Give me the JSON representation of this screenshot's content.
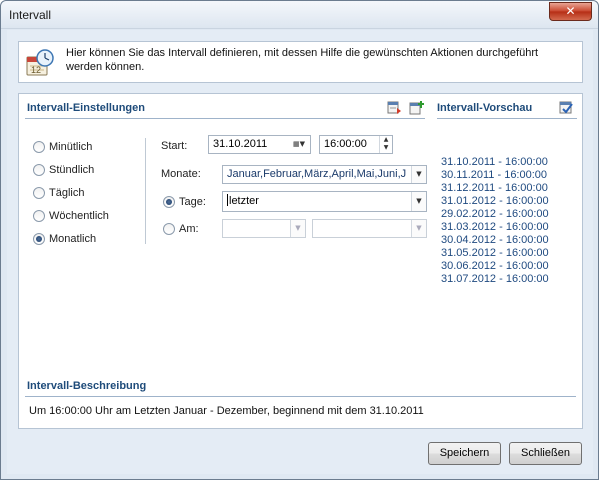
{
  "window": {
    "title": "Intervall",
    "close_glyph": "✕"
  },
  "info": {
    "icon": "calendar-clock-icon",
    "text": "Hier können Sie das Intervall definieren, mit dessen Hilfe die gewünschten Aktionen durchgeführt werden können."
  },
  "settings": {
    "title": "Intervall-Einstellungen",
    "radios": [
      {
        "label": "Minütlich",
        "checked": false
      },
      {
        "label": "Stündlich",
        "checked": false
      },
      {
        "label": "Täglich",
        "checked": false
      },
      {
        "label": "Wöchentlich",
        "checked": false
      },
      {
        "label": "Monatlich",
        "checked": true
      }
    ],
    "start_label": "Start:",
    "start_date": "31.10.2011",
    "start_time": "16:00:00",
    "months_label": "Monate:",
    "months_value": "Januar,Februar,März,April,Mai,Juni,J",
    "days_label": "Tage:",
    "days_value": "letzter",
    "days_checked": true,
    "am_label": "Am:",
    "am_checked": false,
    "am_value1": "",
    "am_value2": ""
  },
  "preview": {
    "title": "Intervall-Vorschau",
    "items": [
      "31.10.2011 - 16:00:00",
      "30.11.2011 - 16:00:00",
      "31.12.2011 - 16:00:00",
      "31.01.2012 - 16:00:00",
      "29.02.2012 - 16:00:00",
      "31.03.2012 - 16:00:00",
      "30.04.2012 - 16:00:00",
      "31.05.2012 - 16:00:00",
      "30.06.2012 - 16:00:00",
      "31.07.2012 - 16:00:00"
    ]
  },
  "description": {
    "title": "Intervall-Beschreibung",
    "text": "Um 16:00:00 Uhr am Letzten Januar - Dezember, beginnend mit dem 31.10.2011"
  },
  "buttons": {
    "save": "Speichern",
    "close": "Schließen"
  },
  "colors": {
    "section_title": "#1e4b7a",
    "preview_text": "#1f4a80",
    "close_button": "#c8452c"
  }
}
